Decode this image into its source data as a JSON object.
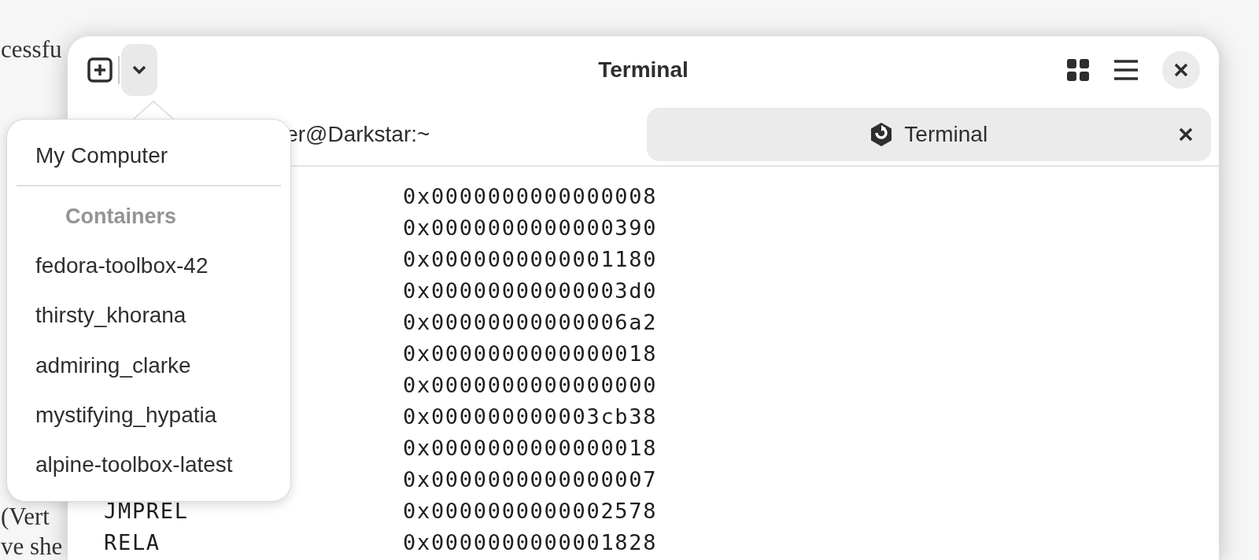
{
  "background_page": {
    "fragments": [
      "cessfu",
      "(Vert",
      "ve she"
    ]
  },
  "window": {
    "title": "Terminal"
  },
  "tabs": [
    {
      "label": "er@Darkstar:~",
      "selected": false
    },
    {
      "label": "Terminal",
      "selected": true
    }
  ],
  "terminal": {
    "rows": [
      {
        "value": "0x0000000000000008"
      },
      {
        "value": "0x0000000000000390"
      },
      {
        "value": "0x0000000000001180"
      },
      {
        "value": "0x00000000000003d0"
      },
      {
        "value": "0x00000000000006a2"
      },
      {
        "value": "0x0000000000000018"
      },
      {
        "value": "0x0000000000000000"
      },
      {
        "value": "0x000000000003cb38"
      },
      {
        "value": "0x0000000000000018"
      },
      {
        "value": "0x0000000000000007"
      },
      {
        "label": "JMPREL",
        "value": "0x0000000000002578"
      },
      {
        "label": "RELA",
        "value": "0x0000000000001828"
      }
    ]
  },
  "popover": {
    "items": [
      {
        "kind": "item",
        "label": "My Computer"
      },
      {
        "kind": "divider"
      },
      {
        "kind": "header",
        "label": "Containers"
      },
      {
        "kind": "item",
        "label": "fedora-toolbox-42"
      },
      {
        "kind": "item",
        "label": "thirsty_khorana"
      },
      {
        "kind": "item",
        "label": "admiring_clarke"
      },
      {
        "kind": "item",
        "label": "mystifying_hypatia"
      },
      {
        "kind": "item",
        "label": "alpine-toolbox-latest"
      }
    ]
  }
}
